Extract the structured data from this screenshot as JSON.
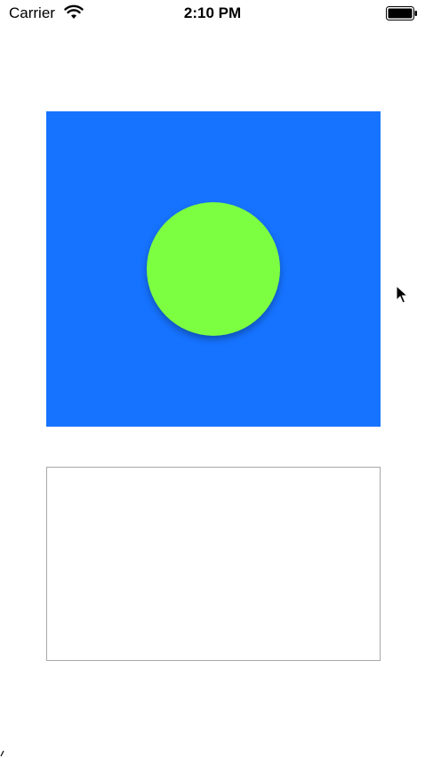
{
  "status_bar": {
    "carrier": "Carrier",
    "time": "2:10 PM",
    "wifi_icon": "wifi-icon",
    "battery_icon": "battery-icon"
  },
  "colors": {
    "blue_view": "#1673ff",
    "green_circle": "#7dff41",
    "box_border": "#a8a8a8"
  },
  "cursor_icon": "mouse-pointer-icon"
}
